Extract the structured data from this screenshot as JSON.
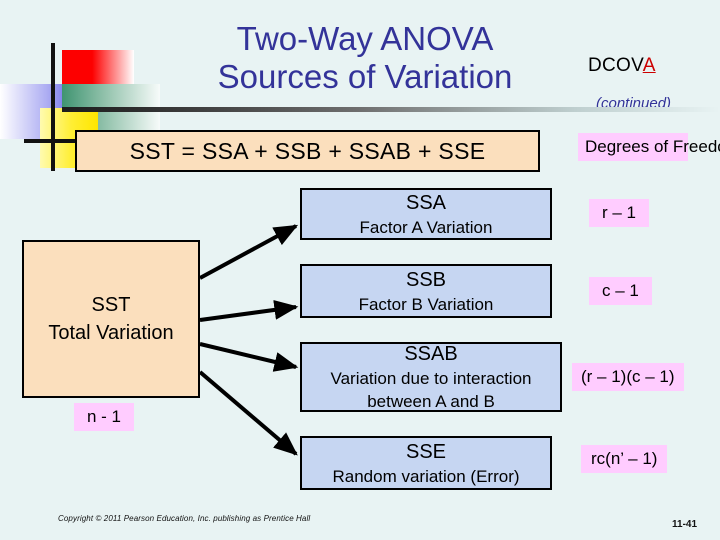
{
  "slide": {
    "title_line1": "Two-Way ANOVA",
    "title_line2": "Sources of Variation",
    "dcova_prefix": "DCOV",
    "dcova_highlight": "A",
    "continued": "(continued)",
    "equation": "SST = SSA + SSB + SSAB + SSE",
    "copyright": "Copyright © 2011 Pearson Education, Inc. publishing as Prentice Hall",
    "page_number": "11-41"
  },
  "source_box": {
    "title": "SST",
    "subtitle": "Total Variation",
    "df": "n - 1"
  },
  "df_header": "Degrees of Freedom:",
  "components": [
    {
      "name": "SSA",
      "description": "Factor A Variation",
      "description2": "",
      "df": "r – 1"
    },
    {
      "name": "SSB",
      "description": "Factor B Variation",
      "description2": "",
      "df": "c – 1"
    },
    {
      "name": "SSAB",
      "description": "Variation due to interaction",
      "description2": "between A and B",
      "df": "(r – 1)(c – 1)"
    },
    {
      "name": "SSE",
      "description": "Random variation (Error)",
      "description2": "",
      "df": "rc(n’ – 1)"
    }
  ],
  "colors": {
    "background": "#e8f3f3",
    "title_text": "#333399",
    "peach_box": "#fbdfbd",
    "blue_box": "#c6d6f2",
    "pink_label": "#ffccff",
    "dcova_accent": "#cc0000",
    "box_border": "#000000"
  }
}
